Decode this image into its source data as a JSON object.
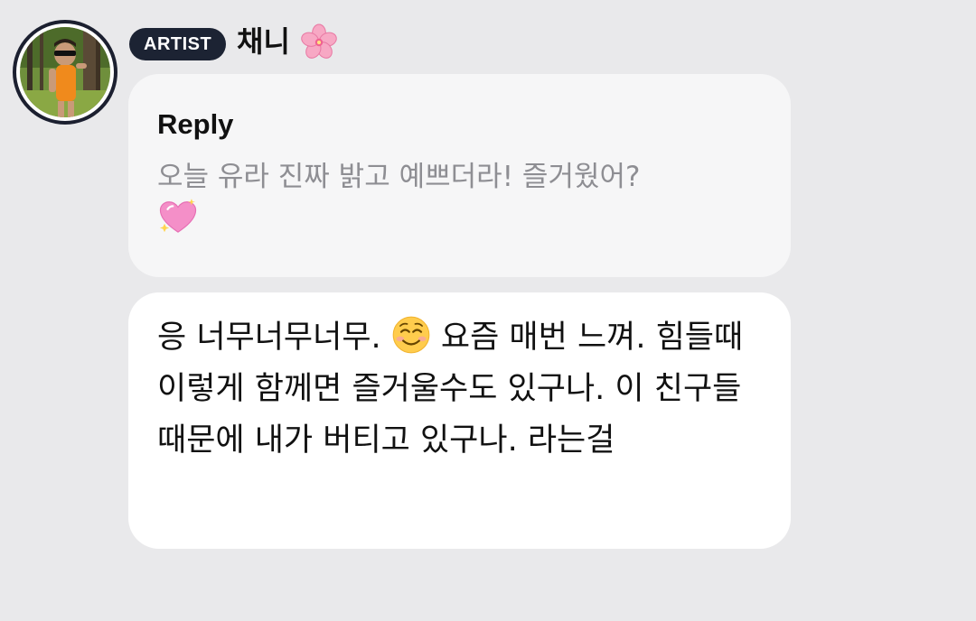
{
  "header": {
    "badge_label": "ARTIST",
    "author_name": "채니"
  },
  "reply": {
    "label": "Reply",
    "quoted_text": "오늘 유라 진짜 밝고 예쁘더라! 즐거웠어?"
  },
  "message": {
    "text_part1": "응 너무너무너무. ",
    "text_part2": " 요즘 매번 느껴. 힘들때 이렇게 함께면 즐거울수도 있구나. 이 친구들 때문에 내가 버티고 있구나. 라는걸"
  },
  "icons": {
    "badge_flower": "cherry-blossom-icon",
    "reply_emoji": "sparkling-heart-icon",
    "message_emoji": "smiling-face-icon"
  },
  "colors": {
    "background": "#e9e9eb",
    "badge": "#1c2333",
    "reply_text": "#8e8e93",
    "bubble": "#ffffff"
  }
}
